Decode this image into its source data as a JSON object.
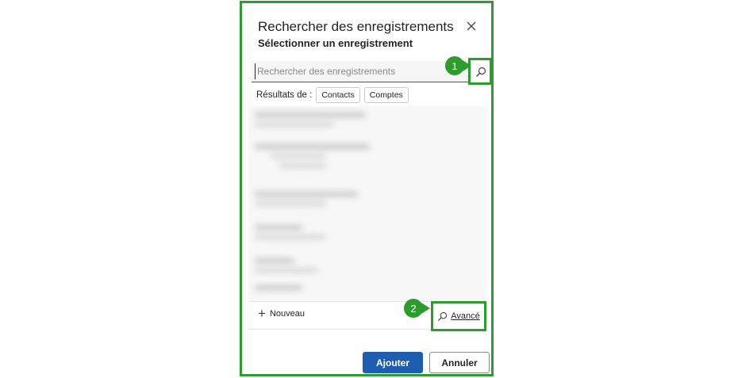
{
  "dialog": {
    "title": "Rechercher des enregistrements",
    "subtitle": "Sélectionner un enregistrement",
    "close_icon": "close-icon"
  },
  "search": {
    "placeholder": "Rechercher des enregistrements",
    "value": "",
    "button_icon": "search-icon"
  },
  "results": {
    "label": "Résultats de :",
    "filters": [
      "Contacts",
      "Comptes"
    ]
  },
  "footer": {
    "new_label": "Nouveau",
    "new_icon": "plus-icon",
    "advanced_label": "Avancé",
    "advanced_icon": "search-icon"
  },
  "callouts": [
    "1",
    "2"
  ],
  "actions": {
    "add_label": "Ajouter",
    "cancel_label": "Annuler"
  },
  "colors": {
    "highlight": "#2e9b2e",
    "primary": "#1f5eaf"
  }
}
